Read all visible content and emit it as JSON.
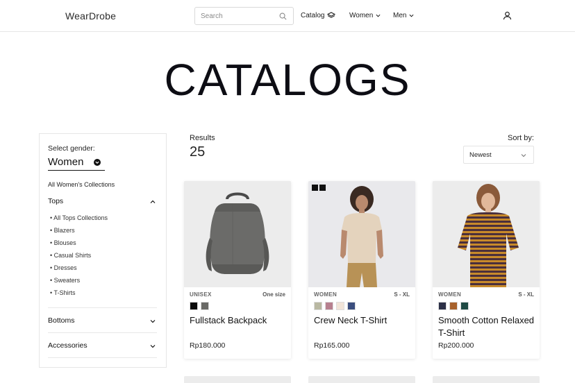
{
  "header": {
    "logo": "WearDrobe",
    "search_placeholder": "Search",
    "nav": {
      "catalog": "Catalog",
      "women": "Women",
      "men": "Men"
    }
  },
  "page": {
    "title": "CATALOGS"
  },
  "sidebar": {
    "select_gender_label": "Select gender:",
    "selected_gender": "Women",
    "all_collections": "All Women's Collections",
    "tops": {
      "label": "Tops",
      "items": [
        "• All Tops Collections",
        "• Blazers",
        "• Blouses",
        "• Casual Shirts",
        "• Dresses",
        "• Sweaters",
        "• T-Shirts"
      ]
    },
    "bottoms_label": "Bottoms",
    "accessories_label": "Accessories"
  },
  "results": {
    "label": "Results",
    "count": "25"
  },
  "sort": {
    "label": "Sort by:",
    "selected": "Newest"
  },
  "products": [
    {
      "category": "UNISEX",
      "size": "One size",
      "swatches": [
        "#0a0a0a",
        "#6a6a66"
      ],
      "name": "Fullstack Backpack",
      "price": "Rp180.000"
    },
    {
      "category": "WOMEN",
      "size": "S - XL",
      "swatches": [
        "#b9b8a2",
        "#b7808f",
        "#f1e4d8",
        "#3b4e7e"
      ],
      "name": "Crew Neck T-Shirt",
      "price": "Rp165.000"
    },
    {
      "category": "WOMEN",
      "size": "S - XL",
      "swatches": [
        "#2c3047",
        "#a8622c",
        "#1f4a44"
      ],
      "name": "Smooth Cotton Relaxed T-Shirt",
      "price": "Rp200.000"
    }
  ],
  "colors": {
    "accent": "#111111",
    "image_bg": "#ececec"
  }
}
